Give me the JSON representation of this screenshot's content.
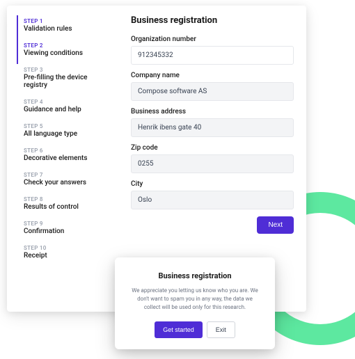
{
  "sidebar": {
    "steps": [
      {
        "label": "STEP 1",
        "title": "Validation rules",
        "active": true
      },
      {
        "label": "STEP 2",
        "title": "Viewing conditions",
        "active": true
      },
      {
        "label": "STEP 3",
        "title": "Pre-filling the device registry",
        "active": false
      },
      {
        "label": "STEP 4",
        "title": "Guidance and help",
        "active": false
      },
      {
        "label": "STEP 5",
        "title": "All language type",
        "active": false
      },
      {
        "label": "STEP 6",
        "title": "Decorative elements",
        "active": false
      },
      {
        "label": "STEP 7",
        "title": "Check your answers",
        "active": false
      },
      {
        "label": "STEP 8",
        "title": "Results of control",
        "active": false
      },
      {
        "label": "STEP 9",
        "title": "Confirmation",
        "active": false
      },
      {
        "label": "STEP 10",
        "title": "Receipt",
        "active": false
      }
    ]
  },
  "form": {
    "title": "Business registration",
    "fields": {
      "org_number": {
        "label": "Organization number",
        "value": "912345332"
      },
      "company_name": {
        "label": "Company name",
        "value": "Compose software AS"
      },
      "business_address": {
        "label": "Business address",
        "value": "Henrik ibens gate 40"
      },
      "zip_code": {
        "label": "Zip code",
        "value": "0255"
      },
      "city": {
        "label": "City",
        "value": "Oslo"
      }
    },
    "next": "Next"
  },
  "modal": {
    "title": "Business registration",
    "text": "We appreciate you letting us know who you are. We don't want to spam you in any way, the data we collect will be used only for this research.",
    "primary": "Get started",
    "secondary": "Exit"
  }
}
